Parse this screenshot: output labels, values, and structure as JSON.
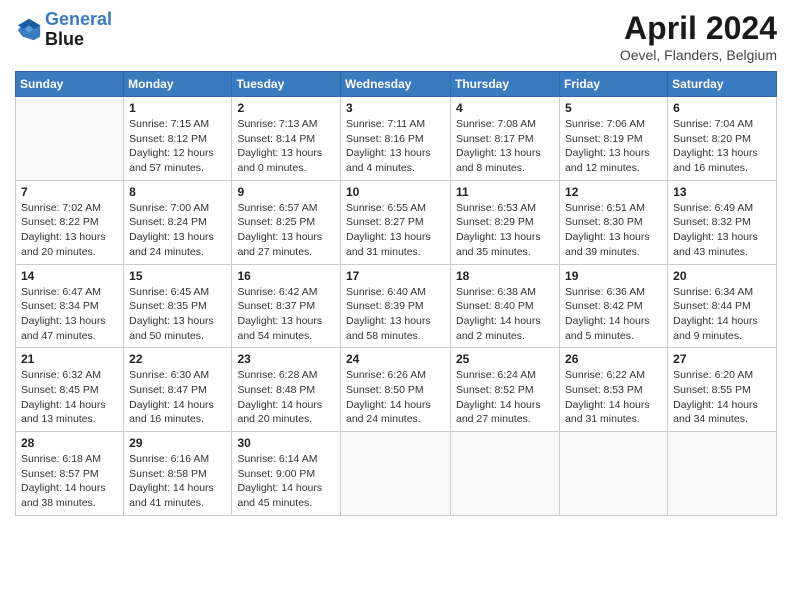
{
  "header": {
    "logo_line1": "General",
    "logo_line2": "Blue",
    "month_title": "April 2024",
    "location": "Oevel, Flanders, Belgium"
  },
  "days_of_week": [
    "Sunday",
    "Monday",
    "Tuesday",
    "Wednesday",
    "Thursday",
    "Friday",
    "Saturday"
  ],
  "weeks": [
    [
      {
        "day": "",
        "info": ""
      },
      {
        "day": "1",
        "info": "Sunrise: 7:15 AM\nSunset: 8:12 PM\nDaylight: 12 hours\nand 57 minutes."
      },
      {
        "day": "2",
        "info": "Sunrise: 7:13 AM\nSunset: 8:14 PM\nDaylight: 13 hours\nand 0 minutes."
      },
      {
        "day": "3",
        "info": "Sunrise: 7:11 AM\nSunset: 8:16 PM\nDaylight: 13 hours\nand 4 minutes."
      },
      {
        "day": "4",
        "info": "Sunrise: 7:08 AM\nSunset: 8:17 PM\nDaylight: 13 hours\nand 8 minutes."
      },
      {
        "day": "5",
        "info": "Sunrise: 7:06 AM\nSunset: 8:19 PM\nDaylight: 13 hours\nand 12 minutes."
      },
      {
        "day": "6",
        "info": "Sunrise: 7:04 AM\nSunset: 8:20 PM\nDaylight: 13 hours\nand 16 minutes."
      }
    ],
    [
      {
        "day": "7",
        "info": "Sunrise: 7:02 AM\nSunset: 8:22 PM\nDaylight: 13 hours\nand 20 minutes."
      },
      {
        "day": "8",
        "info": "Sunrise: 7:00 AM\nSunset: 8:24 PM\nDaylight: 13 hours\nand 24 minutes."
      },
      {
        "day": "9",
        "info": "Sunrise: 6:57 AM\nSunset: 8:25 PM\nDaylight: 13 hours\nand 27 minutes."
      },
      {
        "day": "10",
        "info": "Sunrise: 6:55 AM\nSunset: 8:27 PM\nDaylight: 13 hours\nand 31 minutes."
      },
      {
        "day": "11",
        "info": "Sunrise: 6:53 AM\nSunset: 8:29 PM\nDaylight: 13 hours\nand 35 minutes."
      },
      {
        "day": "12",
        "info": "Sunrise: 6:51 AM\nSunset: 8:30 PM\nDaylight: 13 hours\nand 39 minutes."
      },
      {
        "day": "13",
        "info": "Sunrise: 6:49 AM\nSunset: 8:32 PM\nDaylight: 13 hours\nand 43 minutes."
      }
    ],
    [
      {
        "day": "14",
        "info": "Sunrise: 6:47 AM\nSunset: 8:34 PM\nDaylight: 13 hours\nand 47 minutes."
      },
      {
        "day": "15",
        "info": "Sunrise: 6:45 AM\nSunset: 8:35 PM\nDaylight: 13 hours\nand 50 minutes."
      },
      {
        "day": "16",
        "info": "Sunrise: 6:42 AM\nSunset: 8:37 PM\nDaylight: 13 hours\nand 54 minutes."
      },
      {
        "day": "17",
        "info": "Sunrise: 6:40 AM\nSunset: 8:39 PM\nDaylight: 13 hours\nand 58 minutes."
      },
      {
        "day": "18",
        "info": "Sunrise: 6:38 AM\nSunset: 8:40 PM\nDaylight: 14 hours\nand 2 minutes."
      },
      {
        "day": "19",
        "info": "Sunrise: 6:36 AM\nSunset: 8:42 PM\nDaylight: 14 hours\nand 5 minutes."
      },
      {
        "day": "20",
        "info": "Sunrise: 6:34 AM\nSunset: 8:44 PM\nDaylight: 14 hours\nand 9 minutes."
      }
    ],
    [
      {
        "day": "21",
        "info": "Sunrise: 6:32 AM\nSunset: 8:45 PM\nDaylight: 14 hours\nand 13 minutes."
      },
      {
        "day": "22",
        "info": "Sunrise: 6:30 AM\nSunset: 8:47 PM\nDaylight: 14 hours\nand 16 minutes."
      },
      {
        "day": "23",
        "info": "Sunrise: 6:28 AM\nSunset: 8:48 PM\nDaylight: 14 hours\nand 20 minutes."
      },
      {
        "day": "24",
        "info": "Sunrise: 6:26 AM\nSunset: 8:50 PM\nDaylight: 14 hours\nand 24 minutes."
      },
      {
        "day": "25",
        "info": "Sunrise: 6:24 AM\nSunset: 8:52 PM\nDaylight: 14 hours\nand 27 minutes."
      },
      {
        "day": "26",
        "info": "Sunrise: 6:22 AM\nSunset: 8:53 PM\nDaylight: 14 hours\nand 31 minutes."
      },
      {
        "day": "27",
        "info": "Sunrise: 6:20 AM\nSunset: 8:55 PM\nDaylight: 14 hours\nand 34 minutes."
      }
    ],
    [
      {
        "day": "28",
        "info": "Sunrise: 6:18 AM\nSunset: 8:57 PM\nDaylight: 14 hours\nand 38 minutes."
      },
      {
        "day": "29",
        "info": "Sunrise: 6:16 AM\nSunset: 8:58 PM\nDaylight: 14 hours\nand 41 minutes."
      },
      {
        "day": "30",
        "info": "Sunrise: 6:14 AM\nSunset: 9:00 PM\nDaylight: 14 hours\nand 45 minutes."
      },
      {
        "day": "",
        "info": ""
      },
      {
        "day": "",
        "info": ""
      },
      {
        "day": "",
        "info": ""
      },
      {
        "day": "",
        "info": ""
      }
    ]
  ]
}
